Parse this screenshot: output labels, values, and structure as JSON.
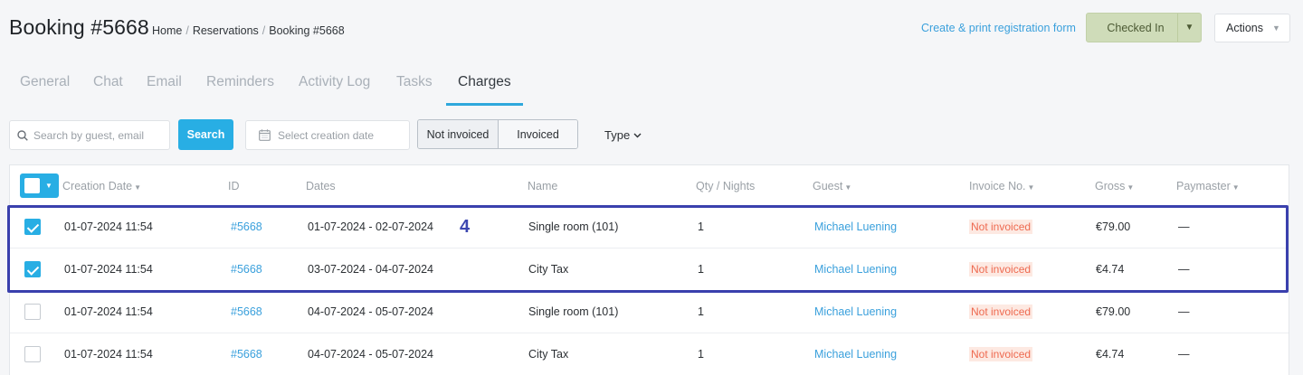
{
  "header": {
    "title": "Booking #5668",
    "breadcrumb": [
      "Home",
      "Reservations",
      "Booking #5668"
    ],
    "registration_link": "Create & print registration form",
    "status_button": "Checked In",
    "actions_button": "Actions"
  },
  "tabs": [
    {
      "label": "General"
    },
    {
      "label": "Chat"
    },
    {
      "label": "Email"
    },
    {
      "label": "Reminders"
    },
    {
      "label": "Activity Log"
    },
    {
      "label": "Tasks"
    },
    {
      "label": "Charges",
      "active": true
    }
  ],
  "filters": {
    "search_placeholder": "Search by guest, email",
    "search_button": "Search",
    "date_placeholder": "Select creation date",
    "segment_options": [
      "Not invoiced",
      "Invoiced"
    ],
    "type_label": "Type"
  },
  "table": {
    "columns": [
      "Creation Date",
      "ID",
      "Dates",
      "Name",
      "Qty / Nights",
      "Guest",
      "Invoice No.",
      "Gross",
      "Paymaster"
    ],
    "rows": [
      {
        "checked": true,
        "created": "01-07-2024 11:54",
        "id": "#5668",
        "dates": "01-07-2024 - 02-07-2024",
        "name": "Single room (101)",
        "qty": "1",
        "guest": "Michael Luening",
        "invoice": "Not invoiced",
        "gross": "€79.00",
        "paymaster": "—"
      },
      {
        "checked": true,
        "created": "01-07-2024 11:54",
        "id": "#5668",
        "dates": "03-07-2024 - 04-07-2024",
        "name": "City Tax",
        "qty": "1",
        "guest": "Michael Luening",
        "invoice": "Not invoiced",
        "gross": "€4.74",
        "paymaster": "—"
      },
      {
        "checked": false,
        "created": "01-07-2024 11:54",
        "id": "#5668",
        "dates": "04-07-2024 - 05-07-2024",
        "name": "Single room (101)",
        "qty": "1",
        "guest": "Michael Luening",
        "invoice": "Not invoiced",
        "gross": "€79.00",
        "paymaster": "—"
      },
      {
        "checked": false,
        "created": "01-07-2024 11:54",
        "id": "#5668",
        "dates": "04-07-2024 - 05-07-2024",
        "name": "City Tax",
        "qty": "1",
        "guest": "Michael Luening",
        "invoice": "Not invoiced",
        "gross": "€4.74",
        "paymaster": "—"
      }
    ]
  },
  "annotation": {
    "label": "4",
    "color": "#3a40ad"
  },
  "colors": {
    "accent": "#28aee4",
    "status_green": "#cfdcb9",
    "invoice_badge": "#fde9e2"
  }
}
